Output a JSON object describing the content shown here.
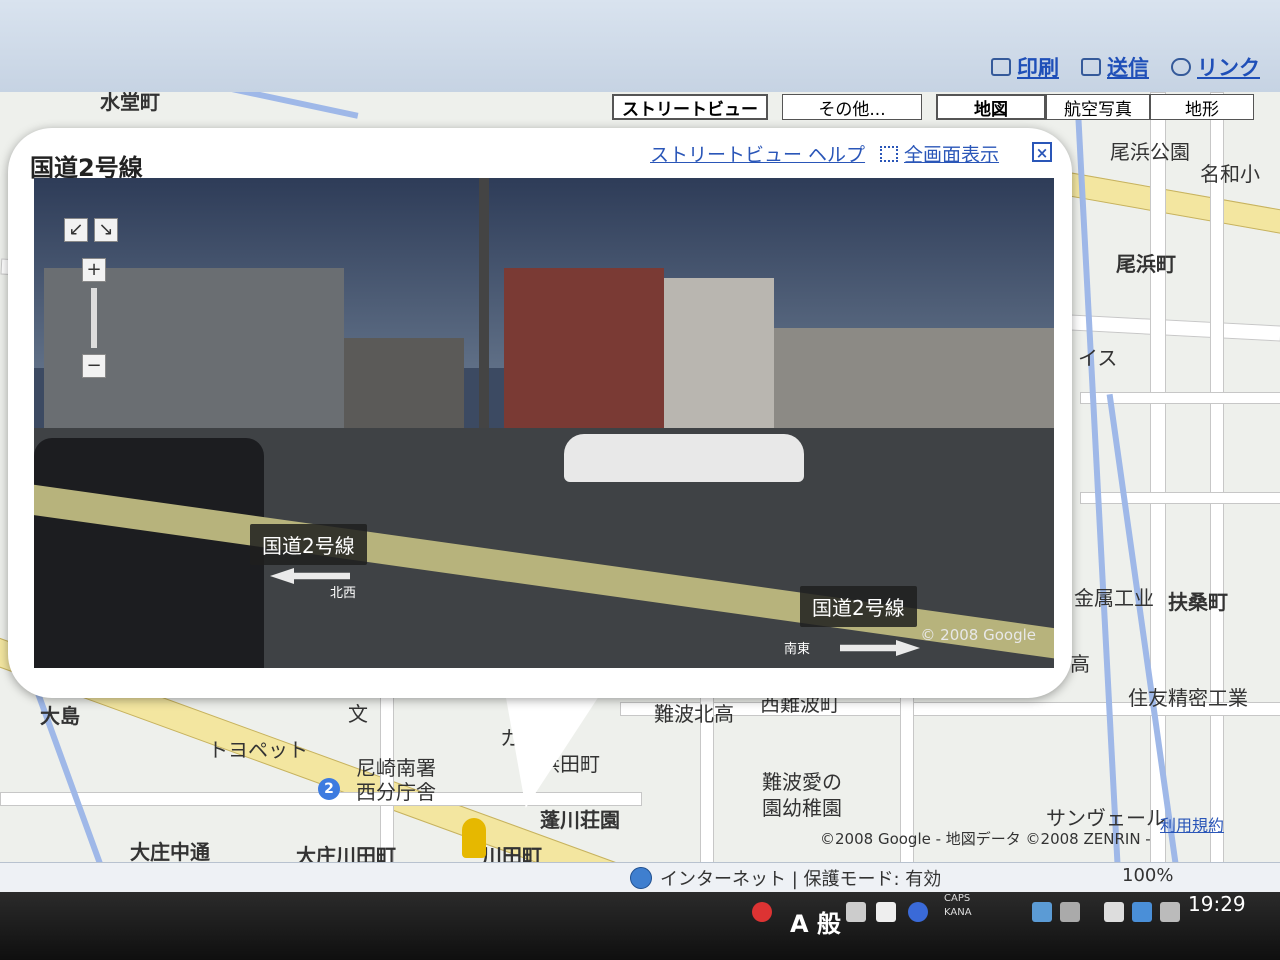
{
  "toolbar": {
    "print": "印刷",
    "send": "送信",
    "link": "リンク"
  },
  "map_types": {
    "streetview": "ストリートビュー",
    "other": "その他...",
    "map": "地図",
    "aerial": "航空写真",
    "terrain": "地形"
  },
  "bubble": {
    "title": "国道2号線",
    "help": "ストリートビュー ヘルプ",
    "fullscreen": "全画面表示",
    "close": "×"
  },
  "pano": {
    "road_label_1": "国道2号線",
    "road_label_2": "国道2号線",
    "dir_nw": "北西",
    "dir_se": "南東",
    "copyright": "© 2008 Google",
    "nav_left": "↙",
    "nav_right": "↘",
    "zoom_in": "+",
    "zoom_out": "−"
  },
  "map_labels": {
    "a": "尾浜公園",
    "b": "名和小",
    "c": "尾浜町",
    "d": "イス",
    "e": "金属工业",
    "f": "扶桑町",
    "g": "高",
    "h": "住友精密工業",
    "i": "難波北高",
    "j": "西難波町",
    "k": "大島",
    "l": "トヨペット",
    "m": "尼崎南署",
    "n": "西分庁舎",
    "o": "カナ",
    "p": "浜田町",
    "q": "蓬川荘園",
    "r": "難波愛の",
    "s": "園幼稚園",
    "t": "大庄中通",
    "u": "大庄川田町",
    "v": "川田町",
    "w": "サンヴェール",
    "x": "利用規約",
    "y": "文",
    "z": "水堂町"
  },
  "map_copyright": "©2008 Google - 地図データ ©2008 ZENRIN -",
  "route_shield": "2",
  "statusbar": {
    "internet": "インターネット | 保護モード: 有効",
    "zoom": "100%"
  },
  "taskbar": {
    "ime": "A 般",
    "caps": "CAPS",
    "kana": "KANA",
    "clock": "19:29"
  }
}
